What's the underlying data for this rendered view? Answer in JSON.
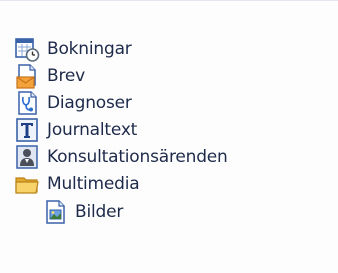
{
  "tree": {
    "items": [
      {
        "label": "Bokningar",
        "icon": "calendar-clock-icon",
        "level": 0
      },
      {
        "label": "Brev",
        "icon": "letter-envelope-icon",
        "level": 0
      },
      {
        "label": "Diagnoser",
        "icon": "stethoscope-document-icon",
        "level": 0
      },
      {
        "label": "Journaltext",
        "icon": "text-document-icon",
        "level": 0
      },
      {
        "label": "Konsultationsärenden",
        "icon": "person-consultation-icon",
        "level": 0
      },
      {
        "label": "Multimedia",
        "icon": "folder-icon",
        "level": 0
      },
      {
        "label": "Bilder",
        "icon": "image-document-icon",
        "level": 1
      }
    ]
  },
  "colors": {
    "text": "#1e2a4a",
    "border": "#e3e6ee",
    "folder": "#f2c04a"
  }
}
